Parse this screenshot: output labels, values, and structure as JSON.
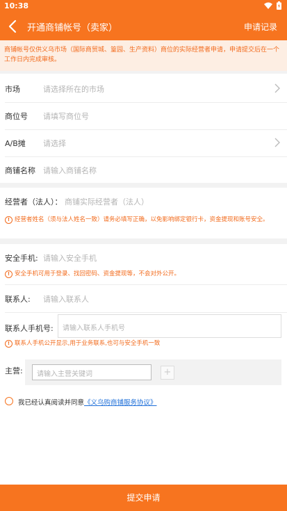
{
  "status": {
    "time": "10:38"
  },
  "header": {
    "title": "开通商铺帐号（卖家）",
    "record_link": "申请记录"
  },
  "notice": "商铺帐号仅供义乌市场（国际商贸城、篁园、生产资料）商位的实际经营者申请，申请提交后在一个工作日内完成审核。",
  "form": {
    "market": {
      "label": "市场",
      "placeholder": "请选择所在的市场"
    },
    "booth": {
      "label": "商位号",
      "placeholder": "请填写商位号"
    },
    "ab": {
      "label": "A/B摊",
      "placeholder": "请选择"
    },
    "shop_name": {
      "label": "商铺名称",
      "placeholder": "请输入商铺名称"
    },
    "operator": {
      "label": "经营者（法人）：",
      "placeholder": "商铺实际经营者（法人）"
    },
    "operator_warn": "经营者姓名（须与法人姓名一致）请务必填写正确，以免影响绑定银行卡，资金提现和账号安全。",
    "phone": {
      "label": "安全手机:",
      "placeholder": "请输入安全手机"
    },
    "phone_warn": "安全手机可用于登录、找回密码、资金提现等，不会对外公开。",
    "contact": {
      "label": "联系人:",
      "placeholder": "请输入联系人"
    },
    "contact_phone": {
      "label": "联系人手机号:",
      "placeholder": "请输入联系人手机号"
    },
    "contact_phone_warn": "联系人手机公开显示,用于业务联系,也可与安全手机一致",
    "main_biz": {
      "label": "主营:",
      "placeholder": "请输入主营关键词",
      "add": "+"
    }
  },
  "agreement": {
    "text": "我已经认真阅读并同意",
    "link": "《义乌购商铺服务协议》"
  },
  "submit_label": "提交申请"
}
